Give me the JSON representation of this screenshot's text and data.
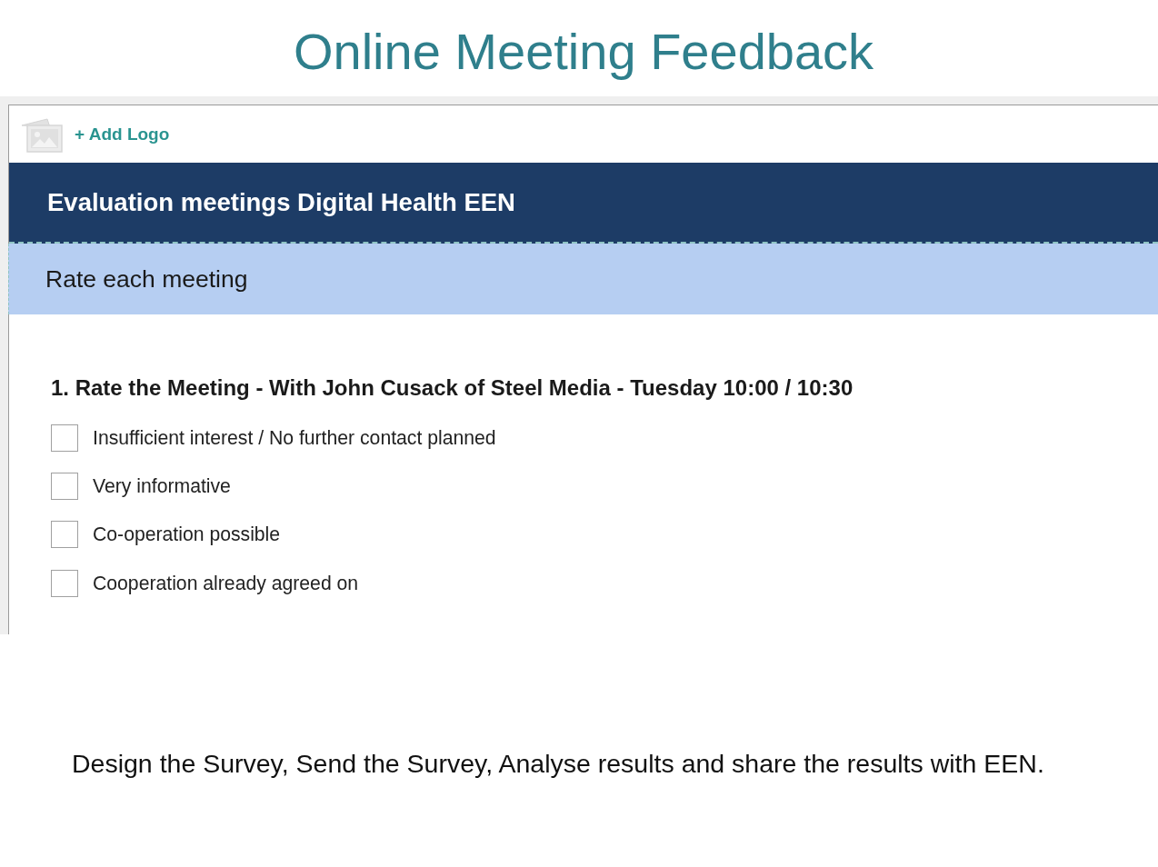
{
  "title": "Online Meeting Feedback",
  "survey": {
    "logo_link": "+ Add Logo",
    "header": "Evaluation meetings Digital Health EEN",
    "page_title": "Rate each meeting",
    "question": {
      "text": "1. Rate the Meeting - With John Cusack of Steel Media - Tuesday 10:00 / 10:30",
      "options": [
        {
          "label": "Insufficient interest / No further contact planned",
          "checked": false
        },
        {
          "label": "Very informative",
          "checked": false
        },
        {
          "label": "Co-operation possible",
          "checked": false
        },
        {
          "label": "Cooperation already agreed on",
          "checked": false
        }
      ]
    }
  },
  "caption": "Design the Survey, Send the Survey, Analyse results and share the results with EEN."
}
